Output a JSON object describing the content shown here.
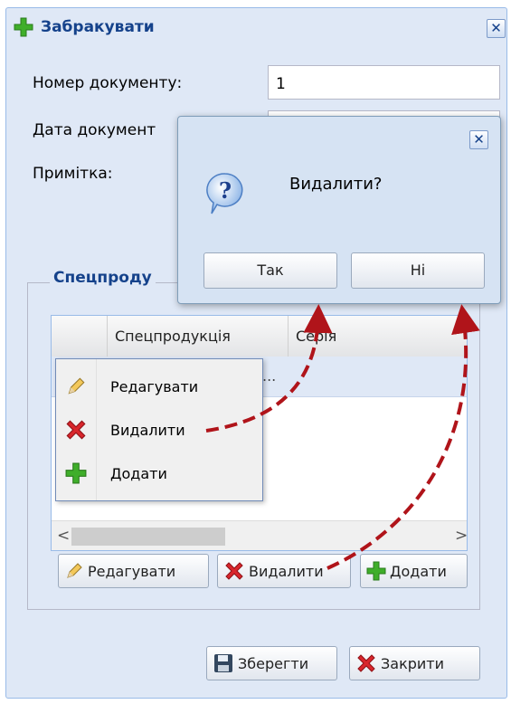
{
  "window": {
    "title": "Забракувати",
    "title_icon": "plus-icon",
    "close_glyph": "✕"
  },
  "form": {
    "doc_number_label": "Номер документу:",
    "doc_number_value": "1",
    "doc_date_label": "Дата документ",
    "note_label": "Примітка:"
  },
  "fieldset": {
    "legend": "Спецпроду"
  },
  "grid": {
    "columns": [
      "Спецпродукція",
      "Серія"
    ],
    "rows": [
      {
        "c1": "...",
        "c2": ""
      }
    ],
    "scroll_left": "<",
    "scroll_right": ">"
  },
  "context_menu": {
    "items": [
      {
        "label": "Редагувати",
        "icon": "pencil-icon"
      },
      {
        "label": "Видалити",
        "icon": "delete-x-icon"
      },
      {
        "label": "Додати",
        "icon": "plus-icon"
      }
    ]
  },
  "grid_toolbar": {
    "edit_label": "Редагувати",
    "delete_label": "Видалити",
    "add_label": "Додати"
  },
  "footer": {
    "save_label": "Зберегти",
    "close_label": "Закрити"
  },
  "dialog": {
    "message": "Видалити?",
    "icon": "question-icon",
    "yes_label": "Так",
    "no_label": "Ні",
    "close_glyph": "✕"
  },
  "colors": {
    "window_bg": "#dfe8f6",
    "title_text": "#15428b",
    "arrow": "#b0141a",
    "plus_green": "#3fae2a",
    "delete_red": "#d9262c"
  }
}
